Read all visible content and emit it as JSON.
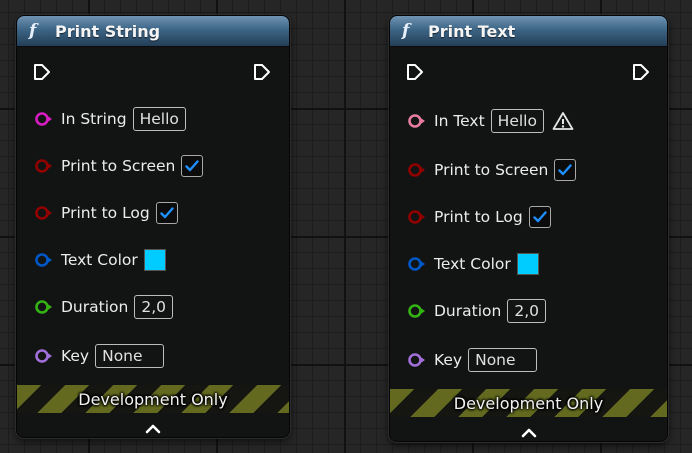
{
  "nodes": [
    {
      "id": "print-string",
      "title": "Print String",
      "icon": "function-icon",
      "func_glyph": "f",
      "in_label": "In String",
      "in_value": "Hello",
      "in_warning": false,
      "print_to_screen_label": "Print to Screen",
      "print_to_screen_checked": true,
      "print_to_log_label": "Print to Log",
      "print_to_log_checked": true,
      "text_color_label": "Text Color",
      "text_color_value": "#00CCFF",
      "duration_label": "Duration",
      "duration_value": "2,0",
      "key_label": "Key",
      "key_value": "None",
      "footer_label": "Development Only"
    },
    {
      "id": "print-text",
      "title": "Print Text",
      "icon": "function-icon",
      "func_glyph": "f",
      "in_label": "In Text",
      "in_value": "Hello",
      "in_warning": true,
      "print_to_screen_label": "Print to Screen",
      "print_to_screen_checked": true,
      "print_to_log_label": "Print to Log",
      "print_to_log_checked": true,
      "text_color_label": "Text Color",
      "text_color_value": "#00CCFF",
      "duration_label": "Duration",
      "duration_value": "2,0",
      "key_label": "Key",
      "key_value": "None",
      "footer_label": "Development Only"
    }
  ],
  "colors": {
    "string_pin": "#d81cc2",
    "text_pin": "#e67ca0",
    "bool_pin": "#930000",
    "struct_pin": "#0058c8",
    "float_pin": "#34b314",
    "name_pin": "#a070d8",
    "exec_pin": "#ffffff",
    "check_mark": "#1e90ff",
    "header_blue": "#3d6585",
    "dev_stripe": "#636a1f"
  }
}
